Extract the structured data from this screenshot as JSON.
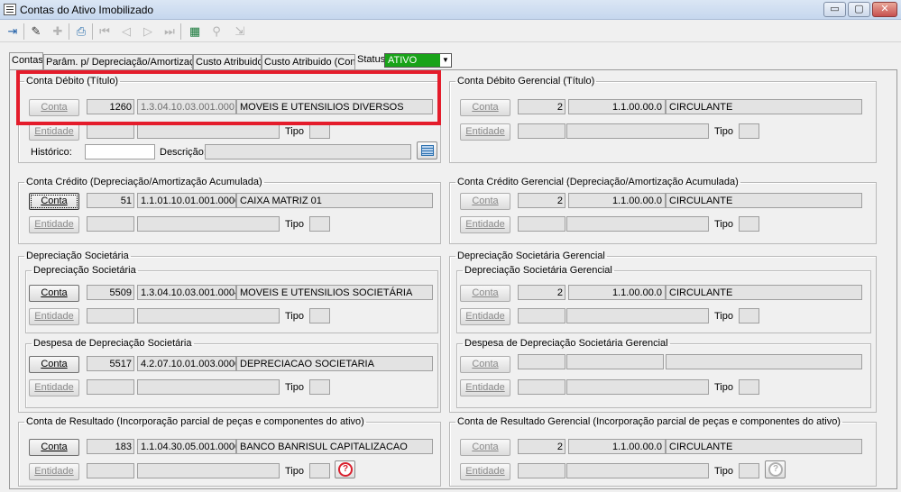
{
  "window": {
    "title": "Contas do Ativo Imobilizado",
    "minimize": "▭",
    "maximize": "▢",
    "close": "✕"
  },
  "tabs": [
    {
      "label": "Contas"
    },
    {
      "label": "Parâm. p/ Depreciação/Amortização"
    },
    {
      "label": "Custo Atribuido"
    },
    {
      "label": "Custo Atribuido (Cont.)"
    }
  ],
  "status": {
    "label": "Status",
    "value": "ATIVO",
    "arrow": "▼"
  },
  "labels": {
    "conta": "Conta",
    "entidade": "Entidade",
    "tipo": "Tipo",
    "historico": "Histórico:",
    "descricao": "Descrição:"
  },
  "groups": {
    "debito": {
      "title": "Conta Débito (Título)",
      "code": "1260",
      "account": "1.3.04.10.03.001.0001",
      "name": "MOVEIS E UTENSILIOS DIVERSOS"
    },
    "debito_ger": {
      "title": "Conta Débito Gerencial (Título)",
      "code": "2",
      "account": "1.1.00.00.0",
      "name": "CIRCULANTE"
    },
    "credito": {
      "title": "Conta Crédito (Depreciação/Amortização Acumulada)",
      "code": "51",
      "account": "1.1.01.10.01.001.0000",
      "name": "CAIXA MATRIZ 01"
    },
    "credito_ger": {
      "title": "Conta Crédito Gerencial (Depreciação/Amortização Acumulada)",
      "code": "2",
      "account": "1.1.00.00.0",
      "name": "CIRCULANTE"
    },
    "dep_soc": {
      "title": "Depreciação Societária",
      "inner": {
        "title": "Depreciação Societária",
        "code": "5509",
        "account": "1.3.04.10.03.001.0004",
        "name": "MOVEIS E UTENSILIOS SOCIETÁRIA"
      },
      "despesa": {
        "title": "Despesa de Depreciação Societária",
        "code": "5517",
        "account": "4.2.07.10.01.003.0000",
        "name": "DEPRECIACAO SOCIETARIA"
      }
    },
    "dep_soc_ger": {
      "title": "Depreciação Societária Gerencial",
      "inner": {
        "title": "Depreciação Societária Gerencial",
        "code": "2",
        "account": "1.1.00.00.0",
        "name": "CIRCULANTE"
      },
      "despesa": {
        "title": "Despesa de Depreciação Societária Gerencial"
      }
    },
    "resultado": {
      "title": "Conta de Resultado (Incorporação parcial de peças e componentes do ativo)",
      "code": "183",
      "account": "1.1.04.30.05.001.0000",
      "name": "BANCO BANRISUL CAPITALIZACAO",
      "help": "?"
    },
    "resultado_ger": {
      "title": "Conta de Resultado Gerencial (Incorporação parcial de peças e componentes do ativo)",
      "code": "2",
      "account": "1.1.00.00.0",
      "name": "CIRCULANTE",
      "help": "?"
    }
  },
  "colors": {
    "highlight": "#e41c2b",
    "status_bg": "#19a319"
  }
}
